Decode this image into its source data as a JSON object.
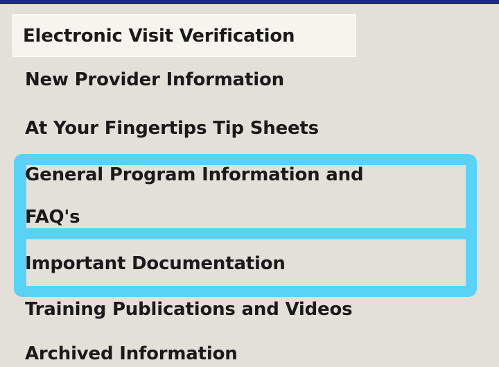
{
  "nav": {
    "active": "Electronic Visit Verification",
    "items": [
      "New Provider Information",
      "At Your Fingertips Tip Sheets",
      "General Program Information and",
      "FAQ's",
      "Important Documentation",
      "Training Publications and Videos",
      "Archived Information"
    ]
  },
  "colors": {
    "top_rule": "#1c2a8c",
    "highlight": "#5ad2f6",
    "background": "#e3e0da"
  }
}
